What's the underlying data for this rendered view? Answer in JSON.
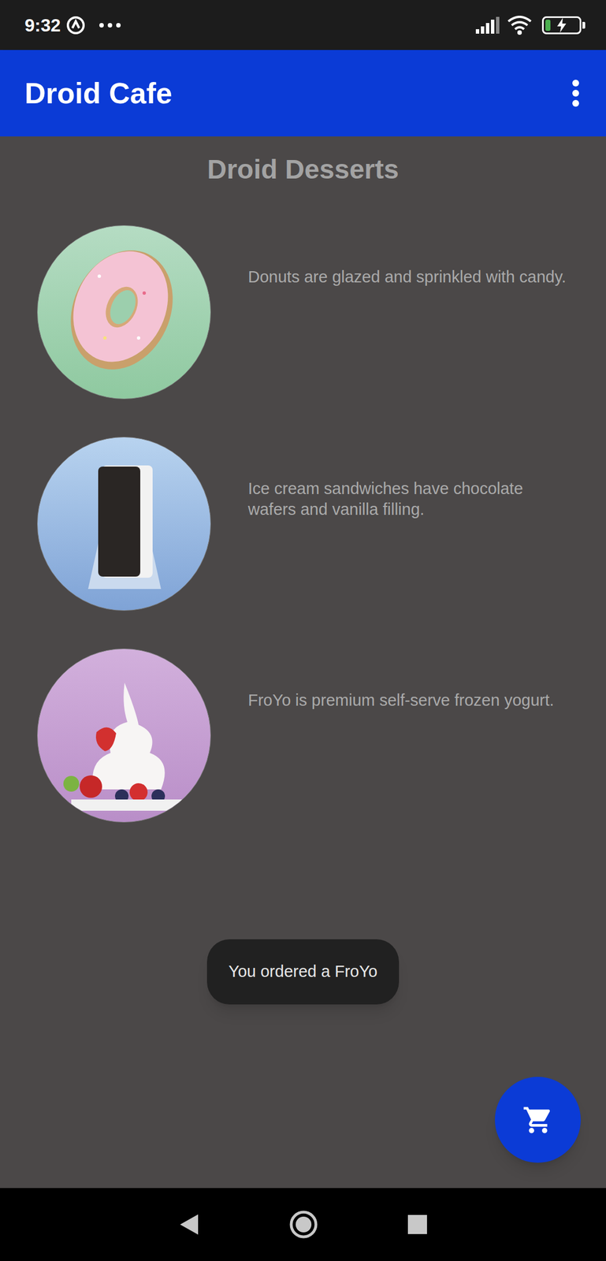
{
  "status_bar": {
    "time": "9:32",
    "battery": {
      "level": 0.15,
      "charging": true
    }
  },
  "app_bar": {
    "title": "Droid Cafe"
  },
  "heading": "Droid Desserts",
  "desserts": [
    {
      "kind": "donut",
      "description": "Donuts are glazed and sprinkled with candy."
    },
    {
      "kind": "sandwich",
      "description": "Ice cream sandwiches have chocolate wafers and vanilla filling."
    },
    {
      "kind": "froyo",
      "description": "FroYo is premium self-serve frozen yogurt."
    }
  ],
  "toast": "You ordered a FroYo"
}
